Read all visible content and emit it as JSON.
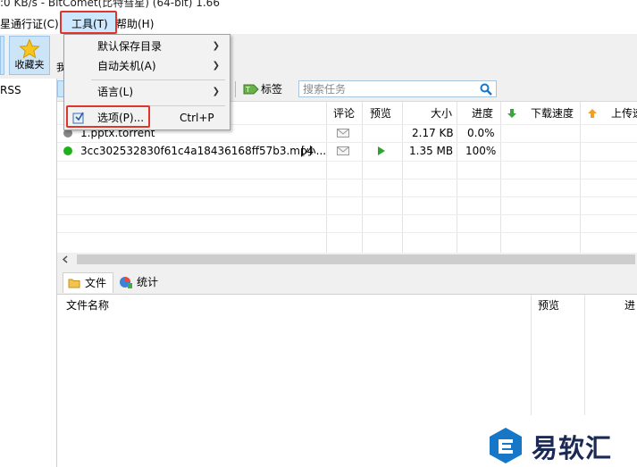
{
  "titlebar": {
    "text": ":0 KB/s - BitComet(比特彗星) (64-bit) 1.66"
  },
  "menubar": {
    "items": [
      {
        "label": "星通行证(C)"
      },
      {
        "label": "工具(T)"
      },
      {
        "label": "帮助(H)"
      }
    ]
  },
  "toolbar": {
    "favorites_label": "收藏夹",
    "clipped_label": "我"
  },
  "sidebar": {
    "rss_label": "RSS"
  },
  "toolbar2": {
    "tag_label": "标签",
    "search_placeholder": "搜索任务"
  },
  "tasklist": {
    "columns": {
      "comment": "评论",
      "preview": "预览",
      "size": "大小",
      "progress": "进度",
      "download_speed": "下载速度",
      "upload_speed": "上传速"
    },
    "rows": [
      {
        "name": "1.pptx.torrent",
        "size": "2.17 KB",
        "progress": "0.0%",
        "status_color": "#888888"
      },
      {
        "name": "3cc302532830f61c4a18436168ff57b3.mp4",
        "tag": "[小...",
        "size": "1.35 MB",
        "progress": "100%",
        "status_color": "#1db11d"
      }
    ]
  },
  "bottom_tabs": {
    "files": "文件",
    "stats": "统计"
  },
  "filelist": {
    "columns": {
      "name": "文件名称",
      "preview": "预览",
      "progress": "进"
    }
  },
  "dropdown": {
    "items": [
      {
        "label": "默认保存目录"
      },
      {
        "label": "自动关机(A)"
      },
      {
        "label": "语言(L)"
      },
      {
        "label": "选项(P)...",
        "shortcut": "Ctrl+P"
      }
    ]
  },
  "watermark": {
    "text": "易软汇"
  },
  "colors": {
    "highlight_red": "#e0352b",
    "selection_blue": "#cce8ff",
    "accent_blue": "#1677c9"
  }
}
